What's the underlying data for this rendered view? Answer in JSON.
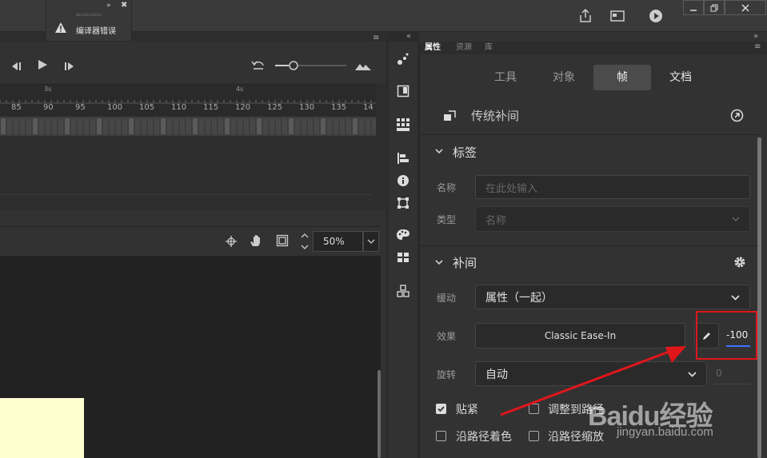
{
  "error_panel": {
    "text": "编译器错误"
  },
  "timeline": {
    "ruler_seconds": [
      "3s",
      "4s"
    ],
    "ruler_frames": [
      "85",
      "90",
      "95",
      "100",
      "105",
      "110",
      "115",
      "120",
      "125",
      "130",
      "135",
      "14"
    ]
  },
  "stage": {
    "zoom_value": "50%"
  },
  "props": {
    "tabs": [
      "属性",
      "资源",
      "库"
    ],
    "segments": [
      "工具",
      "对象",
      "帧",
      "文档"
    ],
    "tween_header": "传统补间",
    "label_section": {
      "title": "标签",
      "name_label": "名称",
      "name_placeholder": "在此处输入",
      "type_label": "类型",
      "type_value": "名称"
    },
    "tween_section": {
      "title": "补间",
      "ease_label": "缓动",
      "ease_value": "属性（一起）",
      "effect_label": "效果",
      "effect_value": "Classic Ease-In",
      "effect_amount": "-100",
      "rotate_label": "旋转",
      "rotate_value": "自动",
      "rotate_count": "0",
      "checkboxes": [
        {
          "label": "贴紧",
          "checked": true
        },
        {
          "label": "调整到路径",
          "checked": false
        },
        {
          "label": "沿路径着色",
          "checked": false
        },
        {
          "label": "沿路径缩放",
          "checked": false
        }
      ]
    }
  },
  "watermark": {
    "brand": "Baidu经验",
    "url": "jingyan.baidu.com"
  },
  "colors": {
    "accent": "#3b73ff",
    "highlight_box": "#e0161a",
    "arrow": "#e0161a",
    "stage_rect": "#ffffd0"
  }
}
